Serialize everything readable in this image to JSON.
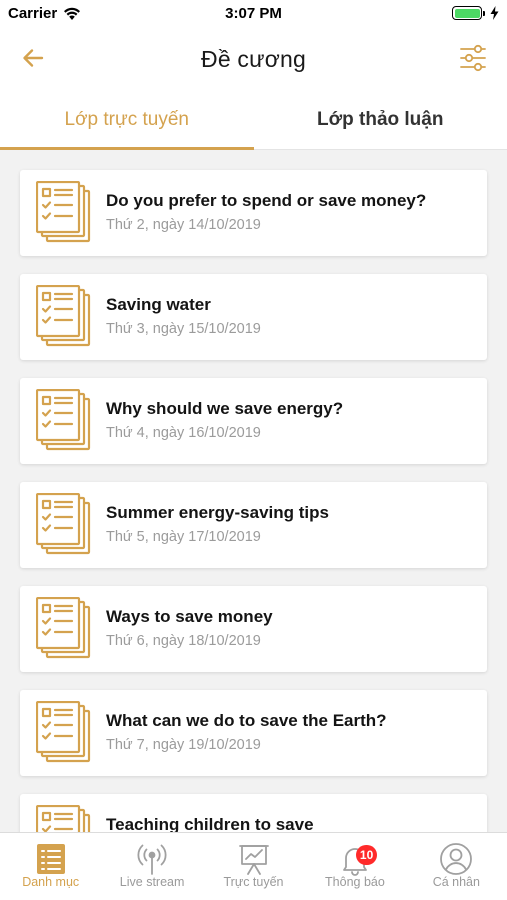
{
  "status": {
    "carrier": "Carrier",
    "time": "3:07 PM"
  },
  "nav": {
    "title": "Đề cương"
  },
  "tabs": [
    {
      "label": "Lớp trực tuyến",
      "active": true
    },
    {
      "label": "Lớp thảo luận",
      "active": false
    }
  ],
  "lessons": [
    {
      "title": "Do you prefer to spend or save money?",
      "date": "Thứ 2, ngày 14/10/2019"
    },
    {
      "title": "Saving water",
      "date": "Thứ 3, ngày 15/10/2019"
    },
    {
      "title": "Why should we save energy?",
      "date": "Thứ 4, ngày 16/10/2019"
    },
    {
      "title": "Summer energy-saving tips",
      "date": "Thứ 5, ngày 17/10/2019"
    },
    {
      "title": "Ways to save money",
      "date": "Thứ 6, ngày 18/10/2019"
    },
    {
      "title": "What can we do to save the Earth?",
      "date": "Thứ 7, ngày 19/10/2019"
    },
    {
      "title": "Teaching children to save",
      "date": ""
    }
  ],
  "tabbar": [
    {
      "label": "Danh mục",
      "icon": "list-icon",
      "active": true
    },
    {
      "label": "Live stream",
      "icon": "broadcast-icon",
      "active": false
    },
    {
      "label": "Trực tuyến",
      "icon": "presentation-icon",
      "active": false
    },
    {
      "label": "Thông báo",
      "icon": "bell-icon",
      "active": false,
      "badge": "10"
    },
    {
      "label": "Cá nhân",
      "icon": "user-icon",
      "active": false
    }
  ],
  "colors": {
    "accent": "#d4a24e",
    "badge": "#ff2a2a",
    "background": "#f2f2f2"
  }
}
